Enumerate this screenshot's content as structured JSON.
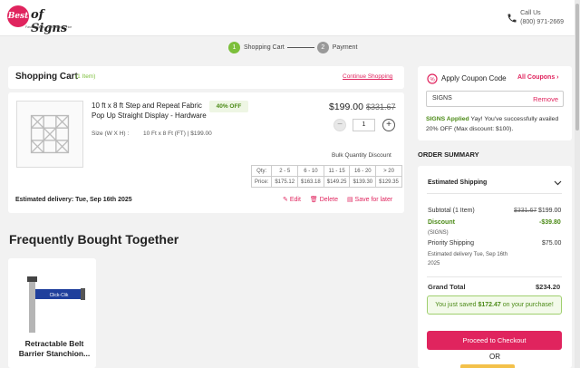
{
  "header": {
    "logo_mark": "Best",
    "logo_text": "of Signs",
    "logo_tagline": "Fastest Signs · Unbeatable Price",
    "call_label": "Call Us",
    "call_number": "(800) 971-2669"
  },
  "steps": [
    {
      "num": "1",
      "label": "Shopping Cart"
    },
    {
      "num": "2",
      "label": "Payment"
    }
  ],
  "cart": {
    "title": "Shopping Cart",
    "count": "(1 Item)",
    "continue_label": "Continue Shopping",
    "item": {
      "name": "10 ft x 8 ft Step and Repeat Fabric Pop Up Straight Display - Hardware",
      "size_label": "Size (W X H) :",
      "size_value": "10 Ft x 8 Ft (FT)  |  $199.00",
      "discount_badge": "40% OFF",
      "price": "$199.00",
      "old_price": "$331.67",
      "quantity": "1"
    },
    "bulk_label": "Bulk Quantity Discount",
    "bulk_qty_header": "Qty:",
    "bulk_price_header": "Price:",
    "bulk_tiers": [
      {
        "qty": "2 - 5",
        "price": "$175.12"
      },
      {
        "qty": "6 - 10",
        "price": "$163.18"
      },
      {
        "qty": "11 - 15",
        "price": "$149.25"
      },
      {
        "qty": "16 - 20",
        "price": "$139.30"
      },
      {
        "qty": "> 20",
        "price": "$129.35"
      }
    ],
    "delivery": "Estimated delivery: Tue, Sep 16th 2025",
    "edit_label": "Edit",
    "delete_label": "Delete",
    "save_label": "Save for later"
  },
  "fbt": {
    "title": "Frequently Bought Together",
    "product_name": "Retractable Belt Barrier Stanchion...",
    "belt_text": "Click-Clik"
  },
  "coupon": {
    "title": "Apply Coupon Code",
    "all_label": "All Coupons",
    "code": "SIGNS",
    "remove_label": "Remove",
    "applied_label": "SIGNS Applied",
    "applied_msg": " Yay! You've successfully availed 20% OFF (Max discount: $100)."
  },
  "summary": {
    "title": "ORDER SUMMARY",
    "shipping_header": "Estimated Shipping",
    "subtotal_label": "Subtotal (1 Item)",
    "subtotal_old": "$331.67",
    "subtotal_value": "$199.00",
    "discount_label": "Discount",
    "discount_value": "-$39.80",
    "discount_code": "(SIGNS)",
    "priority_label": "Priority Shipping",
    "priority_value": "$75.00",
    "priority_delivery": "Estimated delivery Tue, Sep 16th 2025",
    "grand_label": "Grand Total",
    "grand_value": "$234.20",
    "saved_prefix": "You just saved ",
    "saved_amount": "$172.47",
    "saved_suffix": " on your purchase!",
    "checkout_label": "Proceed to Checkout",
    "or_label": "OR"
  },
  "colors": {
    "accent": "#e0245e",
    "success": "#7cbf3b"
  }
}
